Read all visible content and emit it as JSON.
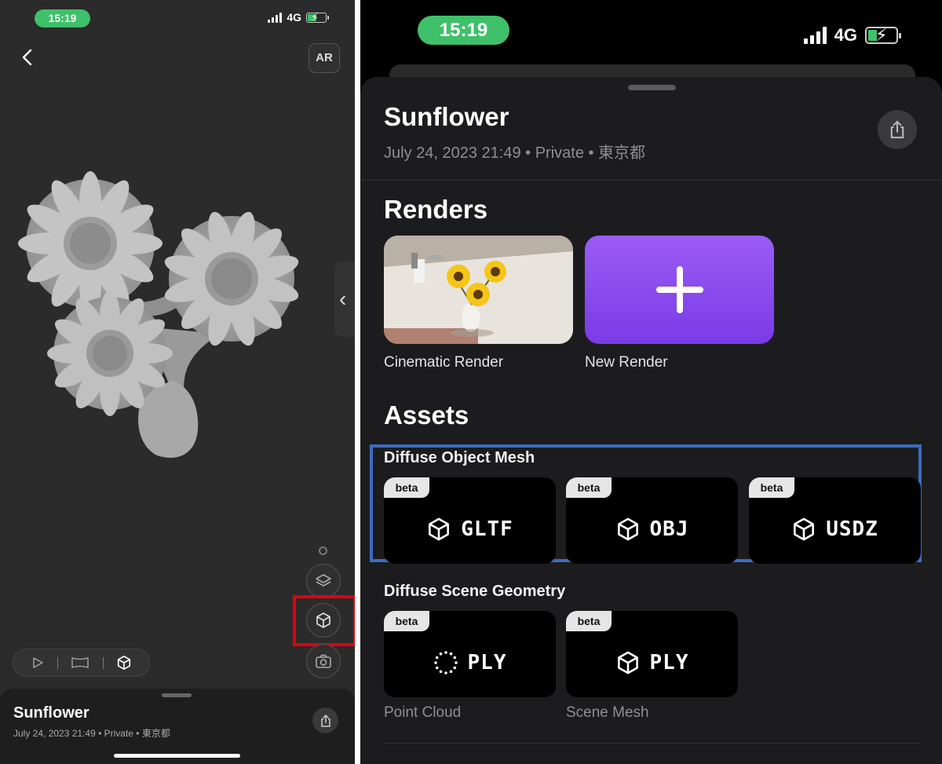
{
  "left": {
    "status": {
      "time": "15:19",
      "network": "4G"
    },
    "ar_label": "AR",
    "sheet": {
      "title": "Sunflower",
      "meta": "July 24, 2023 21:49 • Private • 東京都"
    }
  },
  "right": {
    "status": {
      "time": "15:19",
      "network": "4G"
    },
    "title": "Sunflower",
    "meta": "July 24, 2023 21:49 • Private • 東京都",
    "renders": {
      "heading": "Renders",
      "items": [
        {
          "label": "Cinematic Render"
        },
        {
          "label": "New Render"
        }
      ]
    },
    "assets": {
      "heading": "Assets",
      "groups": [
        {
          "title": "Diffuse Object Mesh",
          "items": [
            {
              "badge": "beta",
              "label": "GLTF",
              "icon": "cube-icon"
            },
            {
              "badge": "beta",
              "label": "OBJ",
              "icon": "cube-icon"
            },
            {
              "badge": "beta",
              "label": "USDZ",
              "icon": "cube-icon"
            }
          ]
        },
        {
          "title": "Diffuse Scene Geometry",
          "items": [
            {
              "badge": "beta",
              "label": "PLY",
              "icon": "point-cloud-icon",
              "subtitle": "Point Cloud"
            },
            {
              "badge": "beta",
              "label": "PLY",
              "icon": "cube-icon",
              "subtitle": "Scene Mesh"
            }
          ]
        }
      ]
    }
  },
  "colors": {
    "status_green": "#3fc06a",
    "new_render_purple": "#8b4cf0",
    "highlight_red": "#e3000f",
    "highlight_blue": "#3c6cc0"
  }
}
